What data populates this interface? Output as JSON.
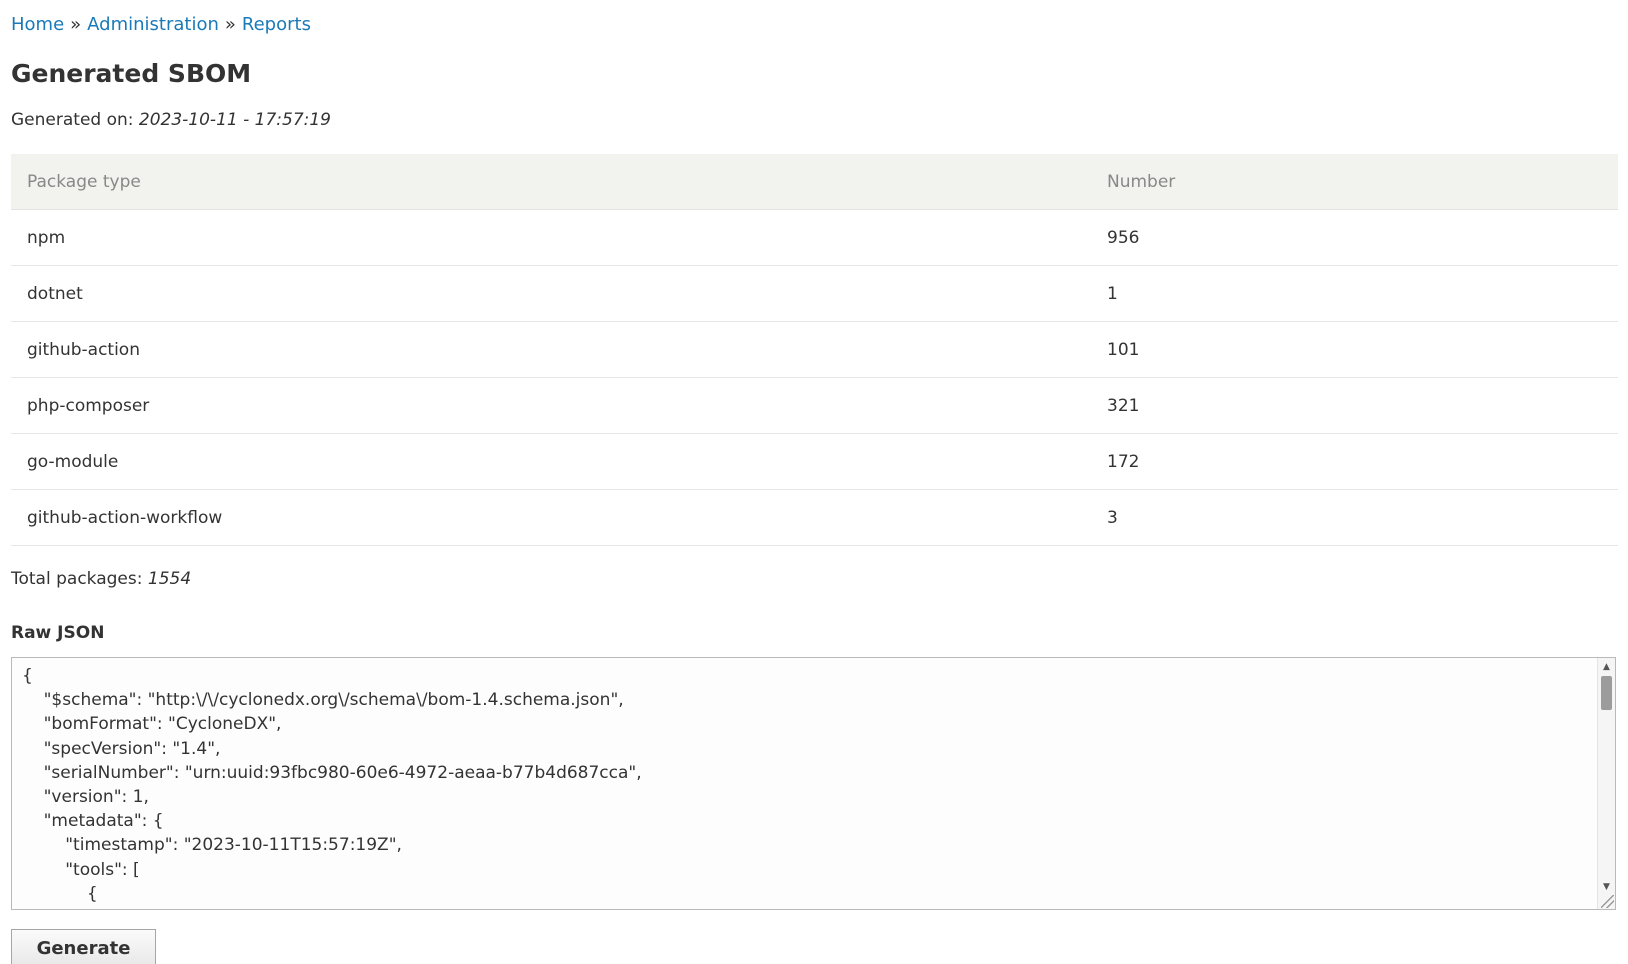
{
  "breadcrumb": {
    "items": [
      "Home",
      "Administration",
      "Reports"
    ],
    "separator": "»"
  },
  "page": {
    "title": "Generated SBOM",
    "generated_label": "Generated on:",
    "generated_value": "2023-10-11 - 17:57:19"
  },
  "table": {
    "headers": [
      "Package type",
      "Number"
    ],
    "rows": [
      [
        "npm",
        "956"
      ],
      [
        "dotnet",
        "1"
      ],
      [
        "github-action",
        "101"
      ],
      [
        "php-composer",
        "321"
      ],
      [
        "go-module",
        "172"
      ],
      [
        "github-action-workflow",
        "3"
      ]
    ]
  },
  "totals": {
    "label": "Total packages:",
    "value": "1554"
  },
  "raw_json": {
    "label": "Raw JSON",
    "content": "{\n    \"$schema\": \"http:\\/\\/cyclonedx.org\\/schema\\/bom-1.4.schema.json\",\n    \"bomFormat\": \"CycloneDX\",\n    \"specVersion\": \"1.4\",\n    \"serialNumber\": \"urn:uuid:93fbc980-60e6-4972-aeaa-b77b4d687cca\",\n    \"version\": 1,\n    \"metadata\": {\n        \"timestamp\": \"2023-10-11T15:57:19Z\",\n        \"tools\": [\n            {"
  },
  "actions": {
    "generate_label": "Generate"
  },
  "colors": {
    "link": "#1a7ab8",
    "table_header_bg": "#f2f2ef"
  }
}
